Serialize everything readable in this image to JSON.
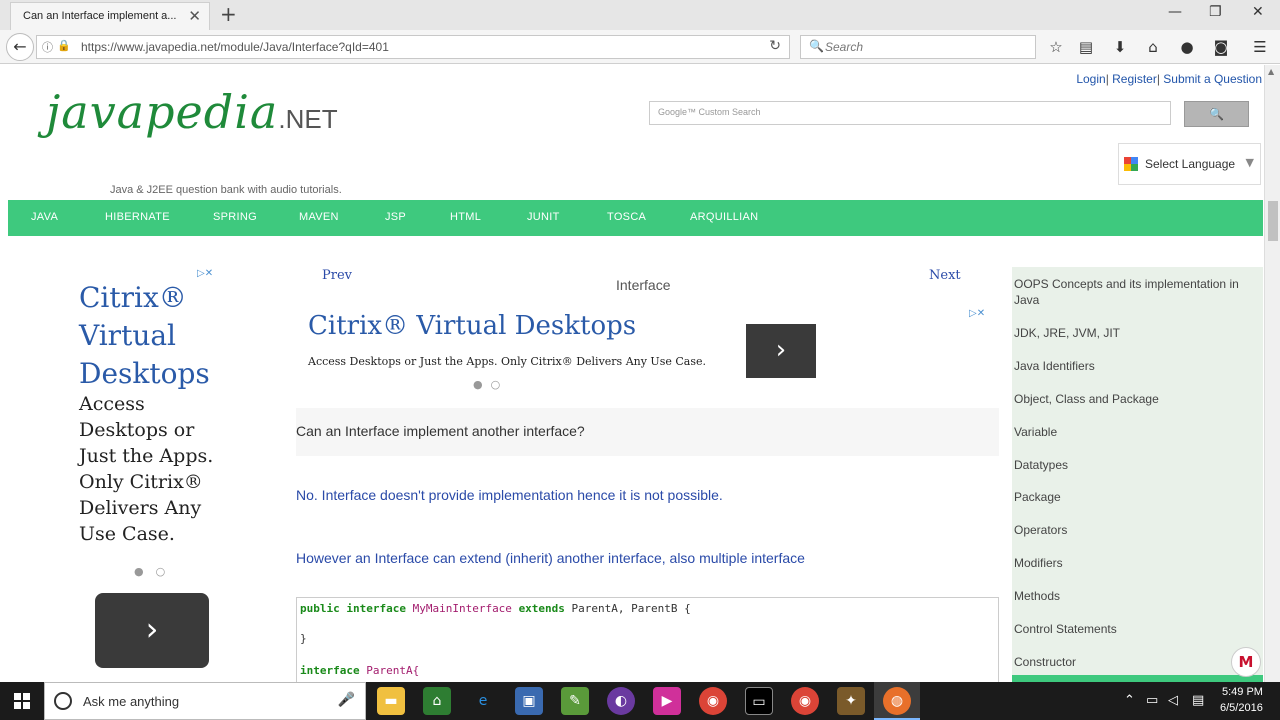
{
  "browser": {
    "tab_title": "Can an Interface implement a...",
    "url": "https://www.javapedia.net/module/Java/Interface?qId=401",
    "search_placeholder": "Search"
  },
  "site": {
    "top_links": [
      "Login",
      "Register",
      "Submit a Question"
    ],
    "logo_main": "javapedia",
    "logo_suffix": ".NET",
    "tagline": "Java & J2EE question bank with audio tutorials.",
    "google_search_placeholder": "Google™ Custom Search",
    "select_language": "Select Language",
    "menu": [
      "JAVA",
      "HIBERNATE",
      "SPRING",
      "MAVEN",
      "JSP",
      "HTML",
      "JUNIT",
      "TOSCA",
      "ARQUILLIAN"
    ]
  },
  "ad_left": {
    "title": "Citrix® Virtual Desktops",
    "body": "Access Desktops or Just the Apps. Only Citrix® Delivers Any Use Case."
  },
  "content": {
    "prev": "Prev",
    "next": "Next",
    "topic": "Interface",
    "ad_title": "Citrix® Virtual Desktops",
    "ad_body": "Access Desktops or Just the Apps. Only Citrix® Delivers Any Use Case.",
    "question": "Can an Interface implement another interface?",
    "answer_1": "No. Interface doesn't provide implementation hence it is not possible.",
    "answer_2": "However an Interface can extend (inherit) another interface, also multiple interface",
    "code": {
      "line1_kw1": "public interface",
      "line1_cls": "MyMainInterface",
      "line1_kw2": "extends",
      "line1_rest": "ParentA, ParentB {",
      "line2": "}",
      "line3_kw": "interface",
      "line3_cls": "ParentA{"
    }
  },
  "sidebar": {
    "items": [
      "OOPS Concepts and its implementation in Java",
      "JDK, JRE, JVM, JIT",
      "Java Identifiers",
      "Object, Class and Package",
      "Variable",
      "Datatypes",
      "Package",
      "Operators",
      "Modifiers",
      "Methods",
      "Control Statements",
      "Constructor"
    ]
  },
  "taskbar": {
    "search_placeholder": "Ask me anything",
    "time": "5:49 PM",
    "date": "6/5/2016"
  },
  "colors": {
    "menu_green": "#3ec97e",
    "link_blue": "#2a4aa8",
    "logo_green": "#1f8a3a",
    "sidebar_bg": "#e9f1e9"
  }
}
